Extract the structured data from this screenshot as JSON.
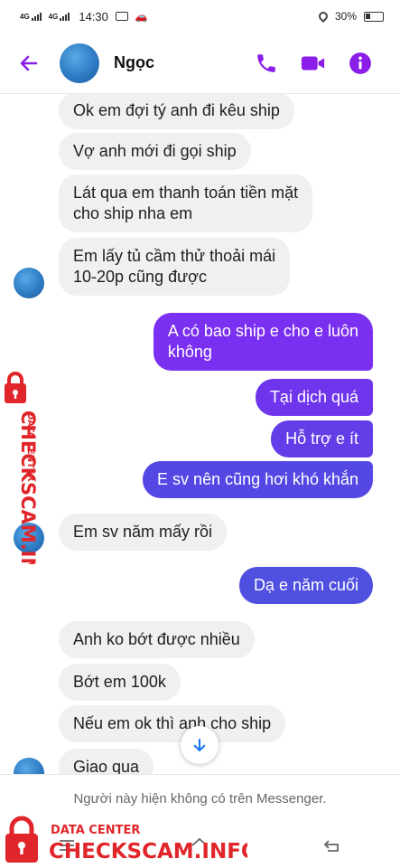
{
  "status_bar": {
    "network_1": "4G",
    "network_2": "4G",
    "time": "14:30",
    "battery": "30%"
  },
  "header": {
    "contact_name": "Ngọc",
    "back_icon": "arrow-left-icon",
    "call_icon": "phone-icon",
    "video_icon": "video-camera-icon",
    "info_icon": "info-icon"
  },
  "messages": [
    {
      "direction": "incoming",
      "lines": [
        "Ok em đợi tý anh đi kêu ship"
      ]
    },
    {
      "direction": "incoming",
      "lines": [
        "Vợ anh mới đi gọi ship"
      ]
    },
    {
      "direction": "incoming",
      "lines": [
        "Lát qua em thanh toán tiền mặt",
        "cho ship nha em"
      ]
    },
    {
      "direction": "incoming",
      "lines": [
        "Em lấy tủ cầm thử thoải mái",
        "10-20p cũng được"
      ]
    },
    {
      "direction": "outgoing",
      "lines": [
        "A có bao ship e cho e luôn",
        "không"
      ]
    },
    {
      "direction": "outgoing",
      "lines": [
        "Tại dịch quá"
      ]
    },
    {
      "direction": "outgoing",
      "lines": [
        "Hỗ trợ e ít"
      ]
    },
    {
      "direction": "outgoing",
      "lines": [
        "E sv nên cũng hơi khó khắn"
      ]
    },
    {
      "direction": "incoming",
      "lines": [
        "Em sv năm mấy rồi"
      ]
    },
    {
      "direction": "outgoing",
      "lines": [
        "Dạ e năm cuối"
      ]
    },
    {
      "direction": "incoming",
      "lines": [
        "Anh ko bớt được nhiều"
      ]
    },
    {
      "direction": "incoming",
      "lines": [
        "Bớt em 100k"
      ]
    },
    {
      "direction": "incoming",
      "lines": [
        "Nếu em ok thì anh cho ship"
      ]
    },
    {
      "direction": "incoming",
      "lines": [
        "Giao qua"
      ]
    }
  ],
  "footer": {
    "unavailable_text": "Người này hiện không có trên Messenger."
  },
  "watermark": {
    "line1": "DATA CENTER",
    "line2": "CHECKSCAM.INFO"
  },
  "colors": {
    "accent": "#8a1ee8",
    "incoming_bubble": "#f0f0f0",
    "outgoing_top": "#7b2ff0",
    "outgoing_bottom": "#4f4fe0",
    "watermark": "#e0262a"
  }
}
